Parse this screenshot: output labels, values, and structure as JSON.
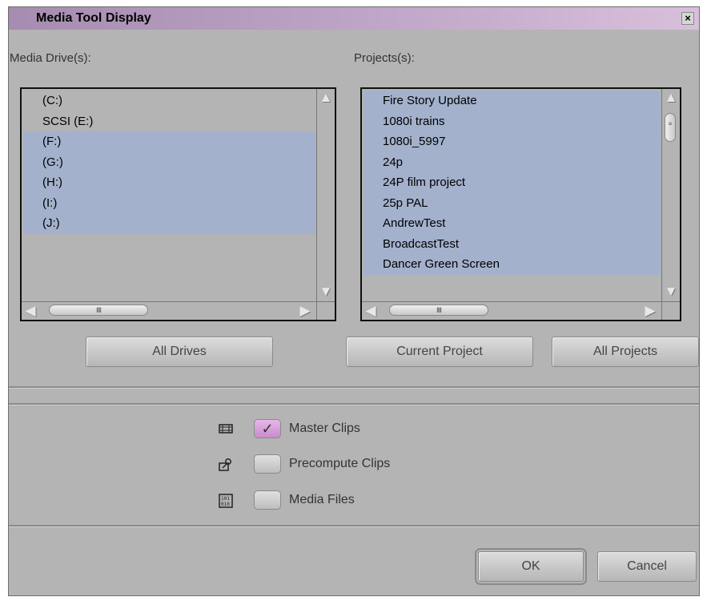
{
  "window": {
    "title": "Media Tool Display",
    "close_symbol": "×"
  },
  "drives": {
    "label": "Media Drive(s):",
    "items": [
      {
        "label": "(C:)",
        "selected": false
      },
      {
        "label": "SCSI (E:)",
        "selected": false
      },
      {
        "label": "(F:)",
        "selected": true
      },
      {
        "label": "(G:)",
        "selected": true
      },
      {
        "label": "(H:)",
        "selected": true
      },
      {
        "label": "(I:)",
        "selected": true
      },
      {
        "label": "(J:)",
        "selected": true
      }
    ],
    "all_button": "All Drives"
  },
  "projects": {
    "label": "Projects(s):",
    "items": [
      {
        "label": "Fire Story Update",
        "selected": true
      },
      {
        "label": "1080i trains",
        "selected": true
      },
      {
        "label": "1080i_5997",
        "selected": true
      },
      {
        "label": "24p",
        "selected": true
      },
      {
        "label": "24P film project",
        "selected": true
      },
      {
        "label": "25p PAL",
        "selected": true
      },
      {
        "label": "AndrewTest",
        "selected": true
      },
      {
        "label": "BroadcastTest",
        "selected": true
      },
      {
        "label": "Dancer Green Screen",
        "selected": true
      }
    ],
    "current_button": "Current Project",
    "all_button": "All Projects"
  },
  "options": [
    {
      "label": "Master Clips",
      "icon": "master-clip-icon",
      "checked": true
    },
    {
      "label": "Precompute Clips",
      "icon": "precompute-clip-icon",
      "checked": false
    },
    {
      "label": "Media Files",
      "icon": "media-file-icon",
      "checked": false
    }
  ],
  "footer": {
    "ok": "OK",
    "cancel": "Cancel"
  },
  "scroll": {
    "thumb_grip": "IIII",
    "v_thumb_grip": "≡"
  },
  "colors": {
    "title_gradient_start": "#a68cb0",
    "selection": "#a3b1cc",
    "checked": "#c88ccb",
    "dialog_bg": "#b4b4b4"
  }
}
